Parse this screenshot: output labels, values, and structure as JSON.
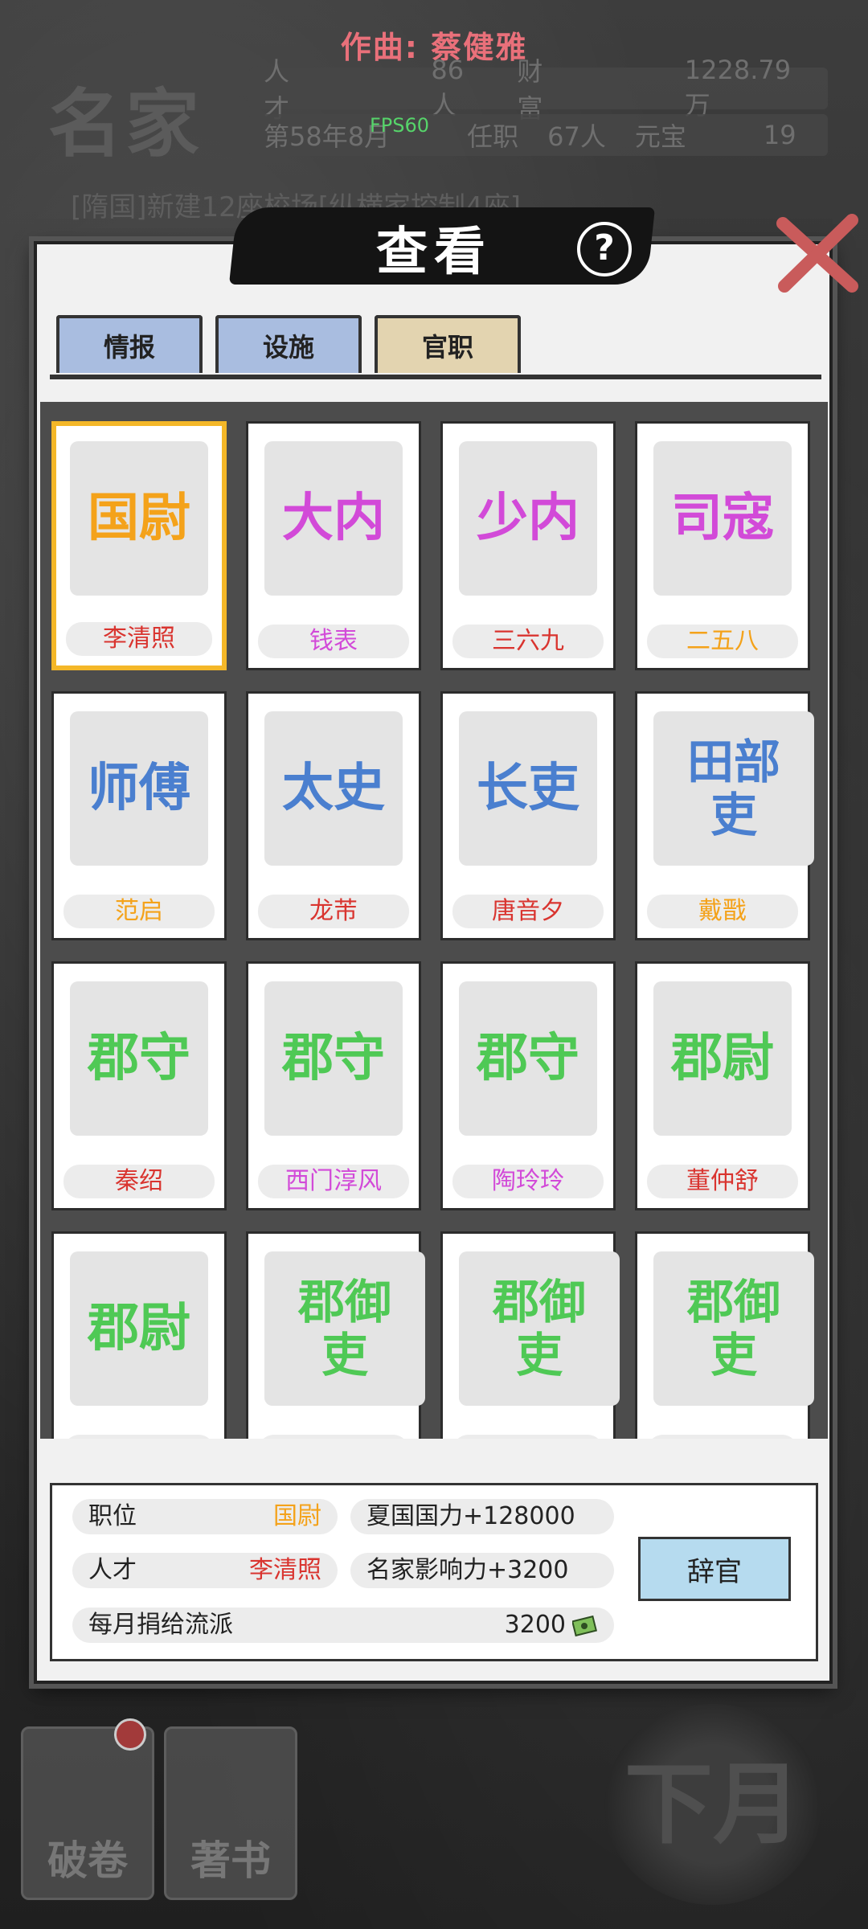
{
  "header": {
    "credit": "作曲: 蔡健雅",
    "brand": "名家",
    "fps": "FPS60",
    "stats": {
      "talent_label": "人才",
      "talent_value": "86人",
      "wealth_label": "财富",
      "wealth_value": "1228.79万",
      "date": "第58年8月",
      "office_label": "任职",
      "office_value": "67人",
      "yuanbao_label": "元宝",
      "yuanbao_value": "19"
    },
    "marquee": "[隋国]新建12座校场[纵横家控制4座]"
  },
  "dialog": {
    "title": "查看",
    "tabs": [
      {
        "label": "情报",
        "active": false
      },
      {
        "label": "设施",
        "active": false
      },
      {
        "label": "官职",
        "active": true
      }
    ],
    "positions": [
      {
        "title": "国尉",
        "holder": "李清照",
        "title_color": "#f4a21a",
        "holder_color": "#d9342f",
        "selected": true
      },
      {
        "title": "大内",
        "holder": "钱表",
        "title_color": "#d24ad8",
        "holder_color": "#d24ad8"
      },
      {
        "title": "少内",
        "holder": "三六九",
        "title_color": "#d24ad8",
        "holder_color": "#d9342f"
      },
      {
        "title": "司寇",
        "holder": "二五八",
        "title_color": "#d24ad8",
        "holder_color": "#f4a21a"
      },
      {
        "title": "师傅",
        "holder": "范启",
        "title_color": "#4a7fcf",
        "holder_color": "#f4a21a"
      },
      {
        "title": "太史",
        "holder": "龙芾",
        "title_color": "#4a7fcf",
        "holder_color": "#d9342f"
      },
      {
        "title": "长吏",
        "holder": "唐音夕",
        "title_color": "#4a7fcf",
        "holder_color": "#d9342f"
      },
      {
        "title": "田部吏",
        "holder": "戴戬",
        "title_color": "#4a7fcf",
        "holder_color": "#f4a21a"
      },
      {
        "title": "郡守",
        "holder": "秦绍",
        "title_color": "#4fc955",
        "holder_color": "#d9342f"
      },
      {
        "title": "郡守",
        "holder": "西门淳风",
        "title_color": "#4fc955",
        "holder_color": "#d24ad8"
      },
      {
        "title": "郡守",
        "holder": "陶玲玲",
        "title_color": "#4fc955",
        "holder_color": "#d24ad8"
      },
      {
        "title": "郡尉",
        "holder": "董仲舒",
        "title_color": "#4fc955",
        "holder_color": "#d9342f"
      },
      {
        "title": "郡尉",
        "holder": "",
        "title_color": "#4fc955",
        "holder_color": "#f4a21a"
      },
      {
        "title": "郡御吏",
        "holder": "",
        "title_color": "#4fc955",
        "holder_color": "#d9342f"
      },
      {
        "title": "郡御吏",
        "holder": "",
        "title_color": "#4fc955",
        "holder_color": "#d9342f"
      },
      {
        "title": "郡御吏",
        "holder": "",
        "title_color": "#4fc955",
        "holder_color": "#d24ad8"
      }
    ],
    "info": {
      "position_label": "职位",
      "position_value": "国尉",
      "talent_label": "人才",
      "talent_value": "李清照",
      "bonus1": "夏国国力+128000",
      "bonus2": "名家影响力+3200",
      "donation_label": "每月捐给流派",
      "donation_value": "3200",
      "resign_label": "辞官"
    }
  },
  "bottom": {
    "left1": "破卷",
    "left2": "著书",
    "next": "下月"
  },
  "colors": {
    "position_value": "#f4a21a",
    "talent_value": "#d9342f"
  }
}
